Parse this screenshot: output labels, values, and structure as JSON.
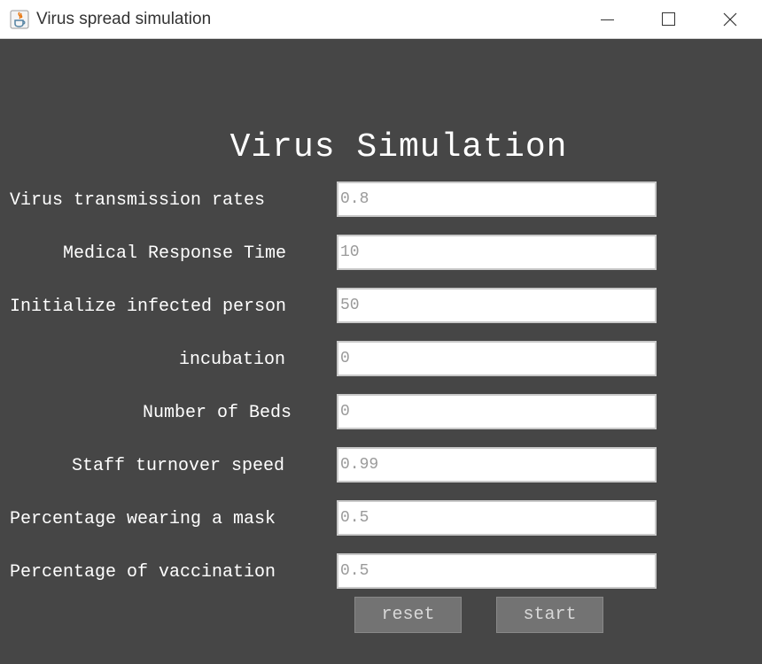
{
  "window": {
    "title": "Virus spread simulation",
    "icon": "java-app-icon",
    "controls": [
      "minimize-icon",
      "maximize-icon",
      "close-icon"
    ]
  },
  "heading": "Virus Simulation",
  "fields": [
    {
      "label": "Virus transmission rates",
      "value": "0.8"
    },
    {
      "label": "Medical Response Time",
      "value": "10"
    },
    {
      "label": "Initialize infected person",
      "value": "50"
    },
    {
      "label": "incubation",
      "value": "0"
    },
    {
      "label": "Number of Beds",
      "value": "0"
    },
    {
      "label": "Staff turnover speed",
      "value": "0.99"
    },
    {
      "label": "Percentage wearing a mask",
      "value": "0.5"
    },
    {
      "label": "Percentage of vaccination",
      "value": "0.5"
    }
  ],
  "buttons": {
    "reset": "reset",
    "start": "start"
  },
  "colors": {
    "background": "#464646",
    "title_bar": "#ffffff",
    "button_fill": "#737373",
    "input_text": "#9a9a9a"
  }
}
